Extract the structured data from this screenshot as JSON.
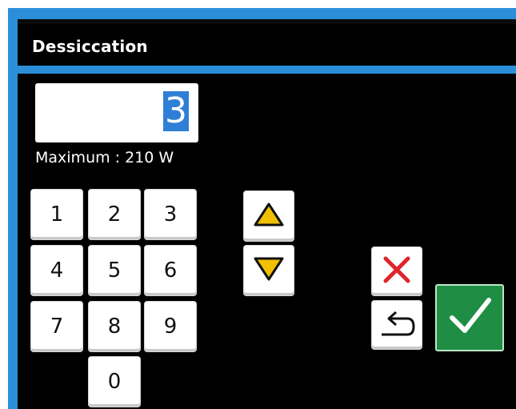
{
  "window": {
    "title": "Dessiccation"
  },
  "display": {
    "value": "3"
  },
  "limits": {
    "maximum_label": "Maximum : 210 W"
  },
  "keypad": {
    "keys": [
      "1",
      "2",
      "3",
      "4",
      "5",
      "6",
      "7",
      "8",
      "9",
      "0"
    ]
  },
  "controls": {
    "increment_icon": "triangle-up-icon",
    "decrement_icon": "triangle-down-icon",
    "cancel_icon": "cross-icon",
    "back_icon": "return-arrow-icon",
    "confirm_icon": "checkmark-icon"
  },
  "colors": {
    "accent_blue": "#2a8fd8",
    "confirm_green": "#1f8d43",
    "cancel_red": "#e0242b",
    "arrow_yellow": "#f0c000",
    "selection_blue": "#2f7fd6"
  }
}
